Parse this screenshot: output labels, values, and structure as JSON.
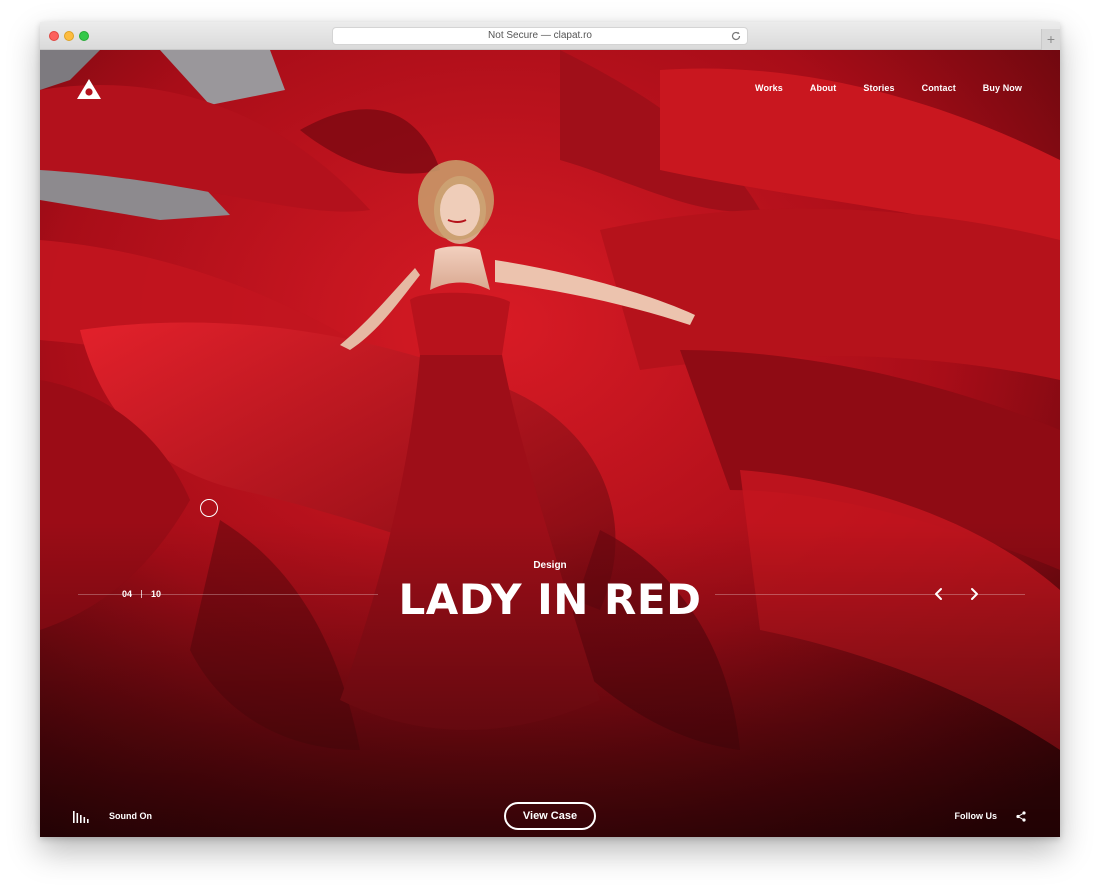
{
  "browser": {
    "address": "Not Secure — clapat.ro",
    "new_tab_symbol": "+"
  },
  "header": {
    "logo_icon": "triangle-logo-icon",
    "nav": [
      "Works",
      "About",
      "Stories",
      "Contact",
      "Buy Now"
    ]
  },
  "slide": {
    "category": "Design",
    "title": "LADY IN RED",
    "current": "04",
    "total": "10",
    "prev_icon": "chevron-left-icon",
    "next_icon": "chevron-right-icon"
  },
  "footer": {
    "sound_label": "Sound On",
    "sound_icon": "equalizer-icon",
    "view_case_label": "View Case",
    "follow_label": "Follow Us",
    "share_icon": "share-icon"
  },
  "colors": {
    "accent_red": "#c8141f",
    "deep_red": "#5a0710",
    "text": "#ffffff"
  }
}
